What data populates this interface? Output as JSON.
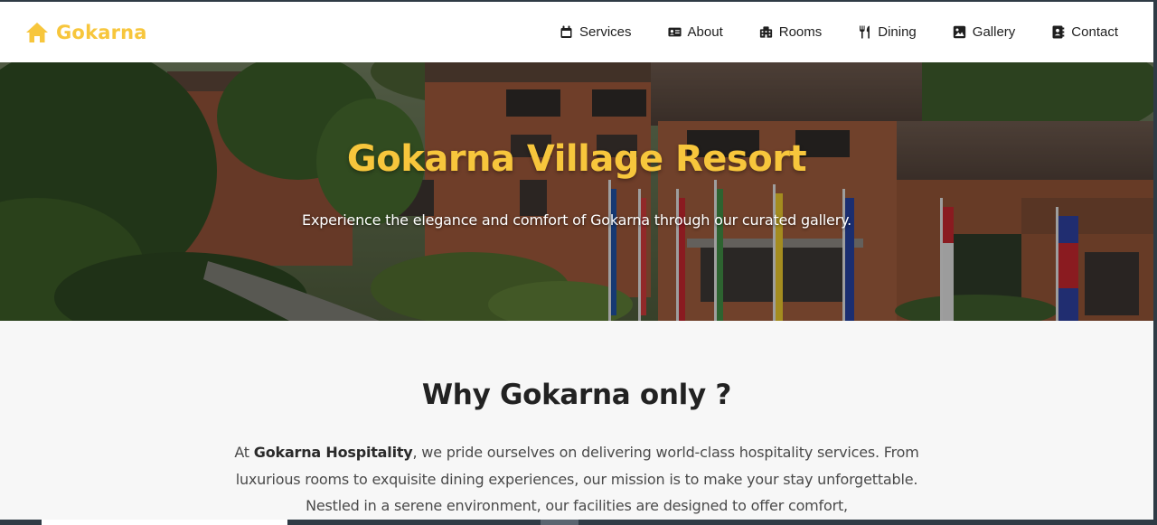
{
  "brand": {
    "name": "Gokarna",
    "icon": "home-icon",
    "color": "#f7c63c"
  },
  "nav": {
    "items": [
      {
        "label": "Services",
        "icon": "calendar-icon"
      },
      {
        "label": "About",
        "icon": "id-card-icon"
      },
      {
        "label": "Rooms",
        "icon": "hotel-icon"
      },
      {
        "label": "Dining",
        "icon": "utensils-icon"
      },
      {
        "label": "Gallery",
        "icon": "image-icon"
      },
      {
        "label": "Contact",
        "icon": "address-book-icon"
      }
    ]
  },
  "hero": {
    "title": "Gokarna Village Resort",
    "subtitle": "Experience the elegance and comfort of Gokarna through our curated gallery.",
    "image": "resort-building-photo"
  },
  "why": {
    "title": "Why Gokarna only ?",
    "intro": "At ",
    "company": "Gokarna Hospitality",
    "body": ", we pride ourselves on delivering world-class hospitality services. From luxurious rooms to exquisite dining experiences, our mission is to make your stay unforgettable. Nestled in a serene environment, our facilities are designed to offer comfort,"
  },
  "colors": {
    "accent": "#f7c63c",
    "heading": "#222222",
    "text": "#4a4a4a",
    "section_bg": "#f7f7f7"
  }
}
